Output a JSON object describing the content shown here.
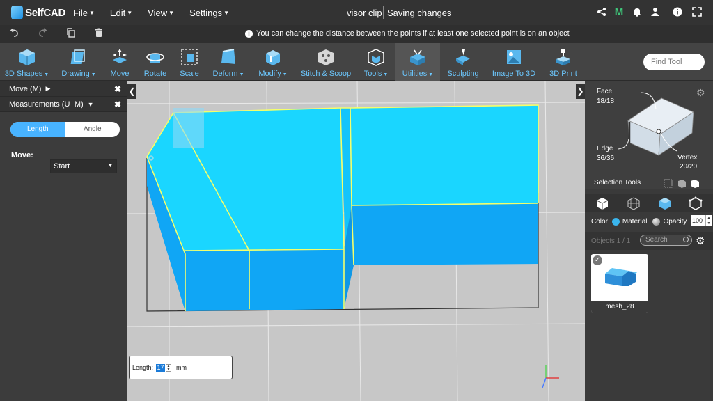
{
  "app": {
    "logo_text": "SelfCAD"
  },
  "menu": [
    {
      "label": "File"
    },
    {
      "label": "Edit"
    },
    {
      "label": "View"
    },
    {
      "label": "Settings"
    }
  ],
  "document": {
    "title": "visor clip",
    "status": "Saving changes"
  },
  "header_icons": [
    "share-icon",
    "m-logo-icon",
    "bell-icon",
    "user-icon",
    "info-icon",
    "fullscreen-icon"
  ],
  "hint": {
    "text": "You can change the distance between the points if at least one selected point is on an object"
  },
  "toolbar": {
    "tools": [
      {
        "label": "3D Shapes",
        "dropdown": true
      },
      {
        "label": "Drawing",
        "dropdown": true
      },
      {
        "label": "Move",
        "dropdown": false
      },
      {
        "label": "Rotate",
        "dropdown": false
      },
      {
        "label": "Scale",
        "dropdown": false
      },
      {
        "label": "Deform",
        "dropdown": true
      },
      {
        "label": "Modify",
        "dropdown": true
      },
      {
        "label": "Stitch & Scoop",
        "dropdown": false
      },
      {
        "label": "Tools",
        "dropdown": true
      },
      {
        "label": "Utilities",
        "dropdown": true
      },
      {
        "label": "Sculpting",
        "dropdown": false
      },
      {
        "label": "Image To 3D",
        "dropdown": false
      },
      {
        "label": "3D Print",
        "dropdown": false
      }
    ],
    "active_tool": "Utilities",
    "find_placeholder": "Find Tool"
  },
  "left_panel": {
    "move_panel": "Move (M)",
    "measurements_panel": "Measurements (U+M)",
    "segment": {
      "left": "Length",
      "right": "Angle",
      "selected": "Length"
    },
    "move_label": "Move:",
    "move_value": "Start"
  },
  "viewport": {
    "length_label": "Length:",
    "length_value": "17",
    "length_unit": "mm"
  },
  "right_panel": {
    "view_cube": {
      "face_label": "Face",
      "face_count": "18/18",
      "edge_label": "Edge",
      "edge_count": "36/36",
      "vertex_label": "Vertex",
      "vertex_count": "20/20"
    },
    "selection_tools_label": "Selection Tools",
    "color_label": "Color",
    "material_label": "Material",
    "opacity_label": "Opacity",
    "opacity_value": "100",
    "objects_count": "Objects 1 / 1",
    "search_placeholder": "Search",
    "object": {
      "name": "mesh_28",
      "selected": true
    }
  },
  "colors": {
    "accent": "#48b3ff",
    "model_top": "#1ad6ff",
    "model_side": "#10a6f5",
    "edge_highlight": "#ffff66",
    "viewport_bg": "#c7c7c7"
  }
}
